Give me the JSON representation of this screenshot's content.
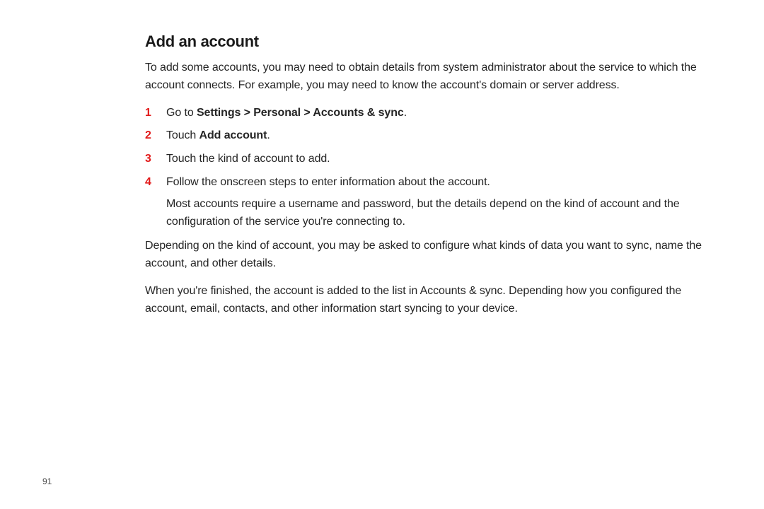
{
  "title": "Add an account",
  "intro": "To add some accounts, you may need to obtain details from system administrator about the service to which the account connects. For example, you may need to know the account's domain or server address.",
  "steps": [
    {
      "num": "1",
      "pre": "Go to ",
      "bold": "Settings > Personal > Accounts & sync",
      "post": "."
    },
    {
      "num": "2",
      "pre": "Touch ",
      "bold": "Add account",
      "post": "."
    },
    {
      "num": "3",
      "text": "Touch the kind of account to add."
    },
    {
      "num": "4",
      "text": "Follow the onscreen steps to enter information about the account.",
      "sub": "Most accounts require a username and password, but the details depend on the kind of account and the configuration of the service you're connecting to."
    }
  ],
  "after1": "Depending on the kind of account, you may be asked to configure what kinds of data you want to sync, name the account, and other details.",
  "after2": "When you're finished, the account is added to the list in Accounts & sync. Depending how you configured the account, email, contacts, and other information start syncing to your device.",
  "pageNumber": "91"
}
